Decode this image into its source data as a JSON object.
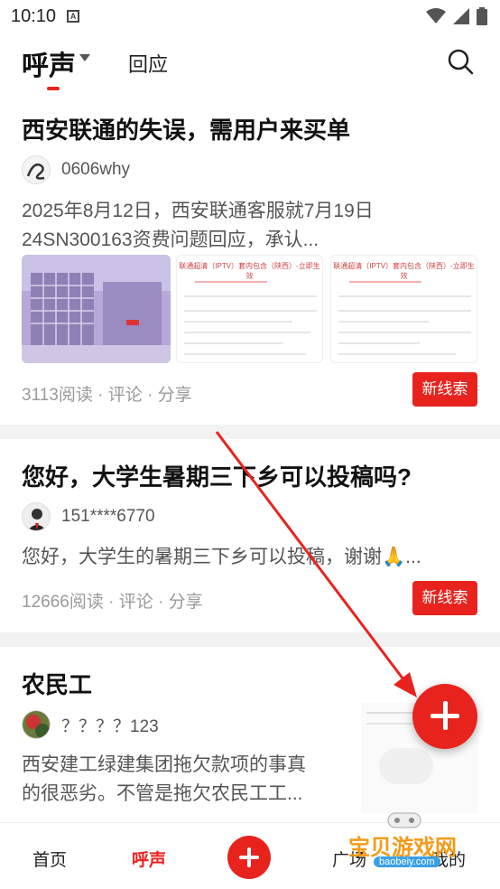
{
  "status_bar": {
    "time": "10:10",
    "notification_badge": "A"
  },
  "header": {
    "tab_active": "呼声",
    "tab_other": "回应"
  },
  "feed": [
    {
      "title": "西安联通的失误，需用户来买单",
      "author": "0606why",
      "excerpt_line1": "2025年8月12日，西安联通客服就7月19日",
      "excerpt_line2": "24SN300163资费问题回应，承认...",
      "doc_title": "联通超清（IPTV）套内包含（陕西）-立即生效",
      "stats": "3113阅读 · 评论 · 分享",
      "clue_label": "新线索"
    },
    {
      "title": "您好，大学生暑期三下乡可以投稿吗?",
      "author": "151****6770",
      "excerpt": "您好，大学生的暑期三下乡可以投稿，谢谢🙏...",
      "stats": "12666阅读 · 评论 · 分享",
      "clue_label": "新线索"
    },
    {
      "title": "农民工",
      "author": "？？？？123",
      "excerpt_line1": "西安建工绿建集团拖欠款项的事真",
      "excerpt_line2": "的很恶劣。不管是拖欠农民工工..."
    }
  ],
  "bottom_nav": {
    "home": "首页",
    "voice": "呼声",
    "square": "广场",
    "mine": "我的"
  },
  "watermark": {
    "title": "宝贝游戏网",
    "url": "baobeiy.com"
  },
  "colors": {
    "accent": "#e8231e"
  }
}
